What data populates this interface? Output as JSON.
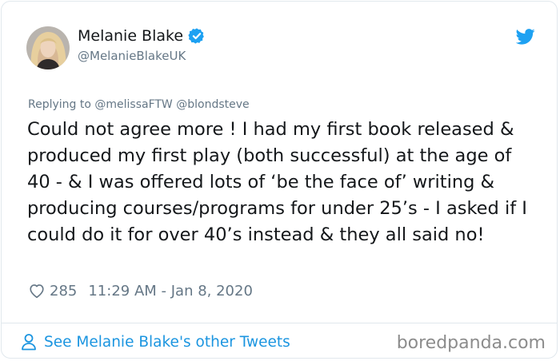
{
  "colors": {
    "accent": "#1b95e0",
    "secondary_text": "#657786",
    "primary_text": "#14171a",
    "border": "#e1e8ed"
  },
  "author": {
    "display_name": "Melanie Blake",
    "handle": "@MelanieBlakeUK",
    "verified": true,
    "avatar_icon": "user-avatar"
  },
  "icons": {
    "brand": "twitter-bird-icon",
    "like": "heart-icon",
    "profile": "user-icon",
    "verified": "verified-badge-icon"
  },
  "tweet": {
    "replying_to": "Replying to @melissaFTW @blondsteve",
    "text": "Could not agree more ! I had my first book released & produced my first play (both successful) at the age of 40 - & I was offered lots of ‘be the face of’ writing & producing courses/programs for under 25’s - I asked if I could do it for over 40’s instead & they all said no!",
    "likes": "285",
    "timestamp": "11:29 AM - Jan 8, 2020"
  },
  "footer": {
    "see_more_label": "See Melanie Blake's other Tweets",
    "watermark": "boredpanda.com"
  }
}
